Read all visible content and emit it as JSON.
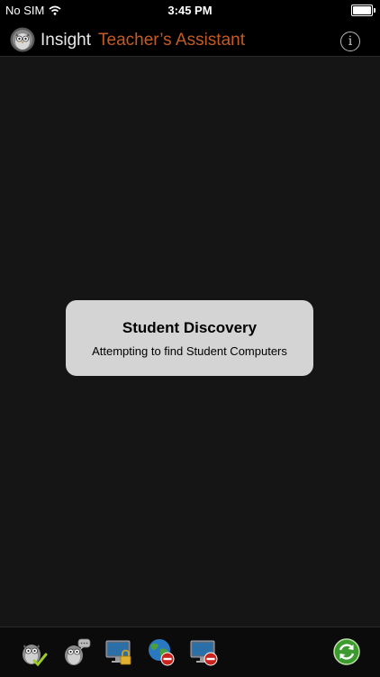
{
  "status_bar": {
    "carrier": "No SIM",
    "time": "3:45 PM"
  },
  "header": {
    "brand": "Insight",
    "title": "Teacher’s Assistant",
    "info_glyph": "i"
  },
  "alert": {
    "title": "Student Discovery",
    "message": "Attempting to find Student Computers"
  },
  "toolbar": {
    "buttons": [
      {
        "icon": "owl-checkmark-icon"
      },
      {
        "icon": "owl-message-icon"
      },
      {
        "icon": "monitor-lock-icon"
      },
      {
        "icon": "globe-block-icon"
      },
      {
        "icon": "monitor-block-icon"
      },
      {
        "icon": "refresh-icon"
      }
    ]
  },
  "colors": {
    "accent_title": "#c45a24",
    "alert_bg": "#d4d4d4",
    "block_red": "#c8231c",
    "refresh_green": "#3d9a2f"
  }
}
